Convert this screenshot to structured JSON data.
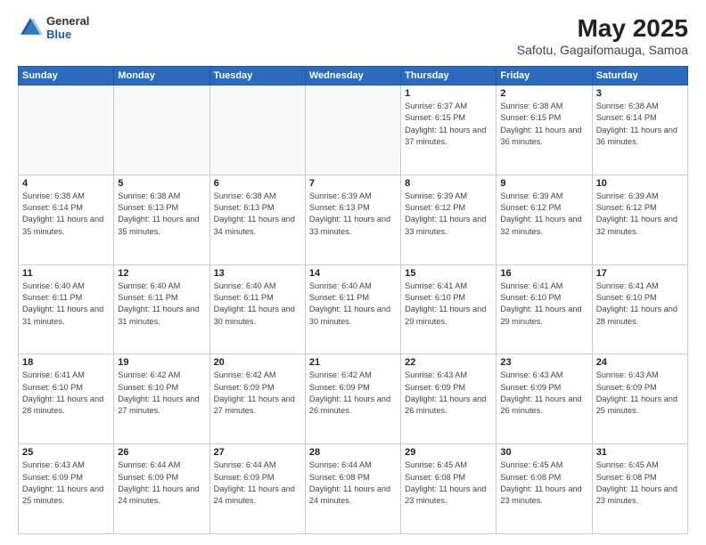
{
  "header": {
    "logo_general": "General",
    "logo_blue": "Blue",
    "main_title": "May 2025",
    "subtitle": "Safotu, Gagaifomauga, Samoa"
  },
  "weekdays": [
    "Sunday",
    "Monday",
    "Tuesday",
    "Wednesday",
    "Thursday",
    "Friday",
    "Saturday"
  ],
  "weeks": [
    [
      {
        "day": "",
        "info": ""
      },
      {
        "day": "",
        "info": ""
      },
      {
        "day": "",
        "info": ""
      },
      {
        "day": "",
        "info": ""
      },
      {
        "day": "1",
        "info": "Sunrise: 6:37 AM\nSunset: 6:15 PM\nDaylight: 11 hours and 37 minutes."
      },
      {
        "day": "2",
        "info": "Sunrise: 6:38 AM\nSunset: 6:15 PM\nDaylight: 11 hours and 36 minutes."
      },
      {
        "day": "3",
        "info": "Sunrise: 6:38 AM\nSunset: 6:14 PM\nDaylight: 11 hours and 36 minutes."
      }
    ],
    [
      {
        "day": "4",
        "info": "Sunrise: 6:38 AM\nSunset: 6:14 PM\nDaylight: 11 hours and 35 minutes."
      },
      {
        "day": "5",
        "info": "Sunrise: 6:38 AM\nSunset: 6:13 PM\nDaylight: 11 hours and 35 minutes."
      },
      {
        "day": "6",
        "info": "Sunrise: 6:38 AM\nSunset: 6:13 PM\nDaylight: 11 hours and 34 minutes."
      },
      {
        "day": "7",
        "info": "Sunrise: 6:39 AM\nSunset: 6:13 PM\nDaylight: 11 hours and 33 minutes."
      },
      {
        "day": "8",
        "info": "Sunrise: 6:39 AM\nSunset: 6:12 PM\nDaylight: 11 hours and 33 minutes."
      },
      {
        "day": "9",
        "info": "Sunrise: 6:39 AM\nSunset: 6:12 PM\nDaylight: 11 hours and 32 minutes."
      },
      {
        "day": "10",
        "info": "Sunrise: 6:39 AM\nSunset: 6:12 PM\nDaylight: 11 hours and 32 minutes."
      }
    ],
    [
      {
        "day": "11",
        "info": "Sunrise: 6:40 AM\nSunset: 6:11 PM\nDaylight: 11 hours and 31 minutes."
      },
      {
        "day": "12",
        "info": "Sunrise: 6:40 AM\nSunset: 6:11 PM\nDaylight: 11 hours and 31 minutes."
      },
      {
        "day": "13",
        "info": "Sunrise: 6:40 AM\nSunset: 6:11 PM\nDaylight: 11 hours and 30 minutes."
      },
      {
        "day": "14",
        "info": "Sunrise: 6:40 AM\nSunset: 6:11 PM\nDaylight: 11 hours and 30 minutes."
      },
      {
        "day": "15",
        "info": "Sunrise: 6:41 AM\nSunset: 6:10 PM\nDaylight: 11 hours and 29 minutes."
      },
      {
        "day": "16",
        "info": "Sunrise: 6:41 AM\nSunset: 6:10 PM\nDaylight: 11 hours and 29 minutes."
      },
      {
        "day": "17",
        "info": "Sunrise: 6:41 AM\nSunset: 6:10 PM\nDaylight: 11 hours and 28 minutes."
      }
    ],
    [
      {
        "day": "18",
        "info": "Sunrise: 6:41 AM\nSunset: 6:10 PM\nDaylight: 11 hours and 28 minutes."
      },
      {
        "day": "19",
        "info": "Sunrise: 6:42 AM\nSunset: 6:10 PM\nDaylight: 11 hours and 27 minutes."
      },
      {
        "day": "20",
        "info": "Sunrise: 6:42 AM\nSunset: 6:09 PM\nDaylight: 11 hours and 27 minutes."
      },
      {
        "day": "21",
        "info": "Sunrise: 6:42 AM\nSunset: 6:09 PM\nDaylight: 11 hours and 26 minutes."
      },
      {
        "day": "22",
        "info": "Sunrise: 6:43 AM\nSunset: 6:09 PM\nDaylight: 11 hours and 26 minutes."
      },
      {
        "day": "23",
        "info": "Sunrise: 6:43 AM\nSunset: 6:09 PM\nDaylight: 11 hours and 26 minutes."
      },
      {
        "day": "24",
        "info": "Sunrise: 6:43 AM\nSunset: 6:09 PM\nDaylight: 11 hours and 25 minutes."
      }
    ],
    [
      {
        "day": "25",
        "info": "Sunrise: 6:43 AM\nSunset: 6:09 PM\nDaylight: 11 hours and 25 minutes."
      },
      {
        "day": "26",
        "info": "Sunrise: 6:44 AM\nSunset: 6:09 PM\nDaylight: 11 hours and 24 minutes."
      },
      {
        "day": "27",
        "info": "Sunrise: 6:44 AM\nSunset: 6:09 PM\nDaylight: 11 hours and 24 minutes."
      },
      {
        "day": "28",
        "info": "Sunrise: 6:44 AM\nSunset: 6:08 PM\nDaylight: 11 hours and 24 minutes."
      },
      {
        "day": "29",
        "info": "Sunrise: 6:45 AM\nSunset: 6:08 PM\nDaylight: 11 hours and 23 minutes."
      },
      {
        "day": "30",
        "info": "Sunrise: 6:45 AM\nSunset: 6:08 PM\nDaylight: 11 hours and 23 minutes."
      },
      {
        "day": "31",
        "info": "Sunrise: 6:45 AM\nSunset: 6:08 PM\nDaylight: 11 hours and 23 minutes."
      }
    ]
  ]
}
